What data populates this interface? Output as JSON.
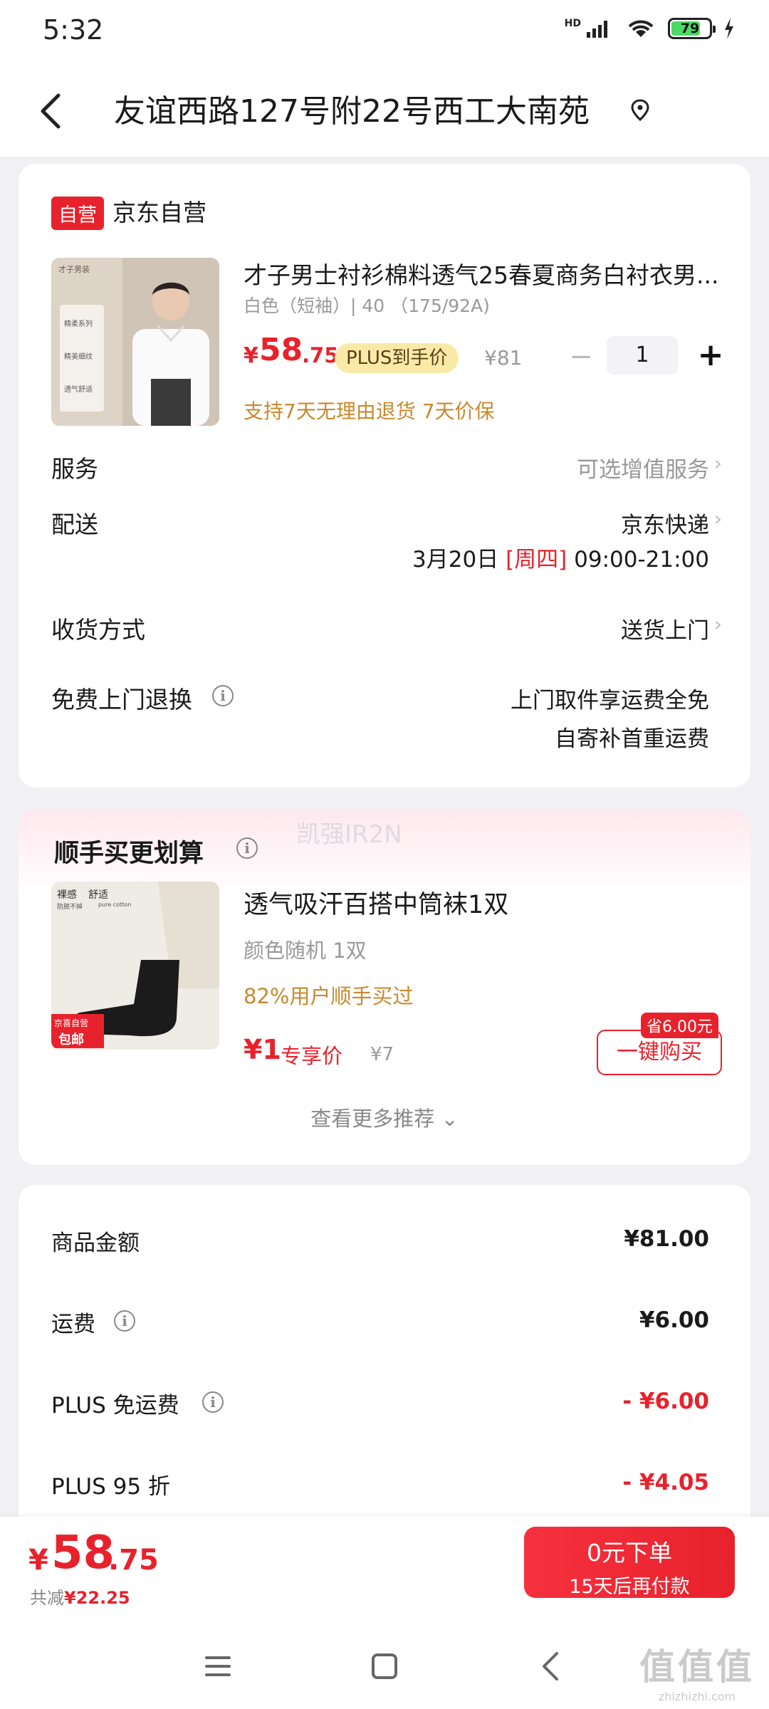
{
  "status_bar": {
    "time": "5:32",
    "network": "HD",
    "battery_level": "79",
    "battery_fraction": 0.79
  },
  "header": {
    "address": "友谊西路127号附22号西工大南苑"
  },
  "order_item": {
    "shop_badge": "自营",
    "shop_name": "京东自营",
    "image_labels": [
      "才子男装",
      "精柔系列",
      "精美细纹",
      "透气舒适"
    ],
    "title": "才子男士衬衫棉料透气25春夏商务白衬衣男...",
    "spec": "白色（短袖）| 40 （175/92A)",
    "price_currency": "¥",
    "price_int": "58",
    "price_dec": ".75",
    "plus_tag": "PLUS到手价",
    "original_price": "¥81",
    "minus": "−",
    "quantity": "1",
    "plus": "+",
    "return_note": "支持7天无理由退货 7天价保"
  },
  "rows": {
    "service_label": "服务",
    "service_value": "可选增值服务",
    "delivery_label": "配送",
    "delivery_value": "京东快递",
    "delivery_date": "3月20日",
    "delivery_weekday": "[周四]",
    "delivery_time": "09:00-21:00",
    "receive_label": "收货方式",
    "receive_value": "送货上门",
    "free_return_label": "免费上门退换",
    "free_return_line1": "上门取件享运费全免",
    "free_return_line2": "自寄补首重运费",
    "chevron": "›",
    "info_glyph": "i"
  },
  "addon": {
    "section_title": "顺手买更划算",
    "watermark": "凯强IR2N",
    "image_labels": [
      "裸感",
      "舒适",
      "防脱不掉",
      "pure cotton",
      "京喜自营",
      "包邮"
    ],
    "title": "透气吸汗百搭中筒袜1双",
    "spec": "颜色随机 1双",
    "bought_note": "82%用户顺手买过",
    "price": "¥1",
    "exclusive_label": "专享价",
    "original_price": "¥7",
    "save_tag": "省6.00元",
    "buy_button": "一键购买",
    "more_recommendations": "查看更多推荐 ⌄"
  },
  "summary": {
    "items": [
      {
        "label": "商品金额",
        "value": "¥81.00",
        "red": false,
        "info": false
      },
      {
        "label": "运费",
        "value": "¥6.00",
        "red": false,
        "info": true
      },
      {
        "label": "PLUS 免运费",
        "value": "- ¥6.00",
        "red": true,
        "info": true
      },
      {
        "label": "PLUS 95 折",
        "value": "- ¥4.05",
        "red": true,
        "info": false
      }
    ]
  },
  "bottom_bar": {
    "total_currency": "¥",
    "total_int": "58",
    "total_dec": ".75",
    "saved_label": "共减",
    "saved_value": "¥22.25",
    "order_button_line1": "0元下单",
    "order_button_line2": "15天后再付款"
  },
  "corner_watermark": {
    "text": "值值值",
    "site": "zhizhizhi.com"
  },
  "colors": {
    "accent": "#e8222c",
    "gold": "#c8892d",
    "plus_tag_bg": "#fbeaa7",
    "page_bg": "#f1f1f3"
  },
  "icons": {
    "back": "back-arrow-icon",
    "location": "location-pin-icon",
    "menu": "menu-icon",
    "home": "home-square-icon",
    "nav_back": "nav-back-icon"
  }
}
